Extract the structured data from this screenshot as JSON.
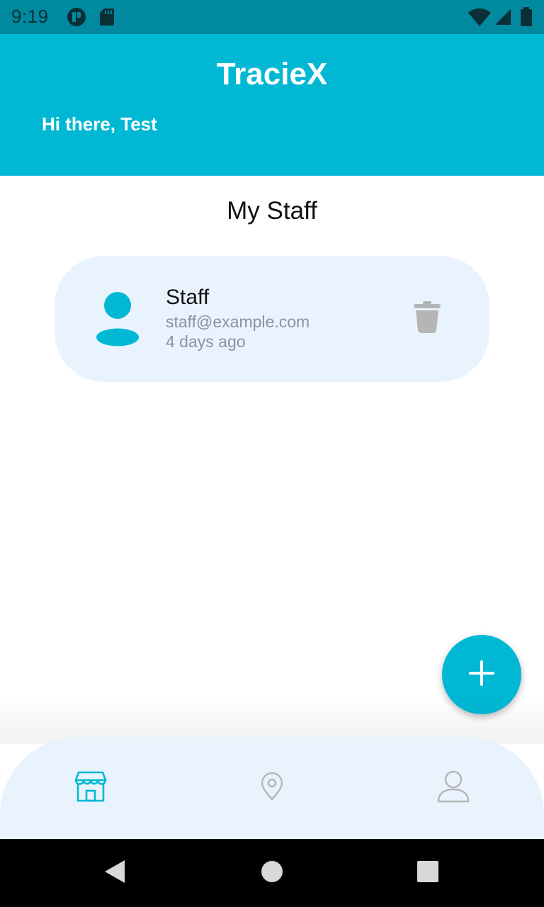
{
  "status_bar": {
    "time": "9:19",
    "icons": [
      "app-notification-icon",
      "sd-card-icon",
      "wifi-icon",
      "signal-icon",
      "battery-icon"
    ]
  },
  "header": {
    "title": "TracieX",
    "greeting": "Hi there, Test"
  },
  "main": {
    "section_title": "My Staff",
    "staff": [
      {
        "name": "Staff",
        "email": "staff@example.com",
        "added": "4 days ago"
      }
    ]
  },
  "fab": {
    "icon": "plus-icon"
  },
  "bottom_nav": {
    "items": [
      {
        "icon": "store-icon",
        "active": true
      },
      {
        "icon": "location-pin-icon",
        "active": false
      },
      {
        "icon": "profile-icon",
        "active": false
      }
    ]
  },
  "system_nav": {
    "buttons": [
      "back-icon",
      "home-icon",
      "recents-icon"
    ]
  },
  "colors": {
    "primary": "#00b8d4",
    "status_bar": "#00899f",
    "card_background": "#e9f3fd",
    "muted_text": "#8a94a0",
    "inactive_icon": "#b5b5b5"
  }
}
